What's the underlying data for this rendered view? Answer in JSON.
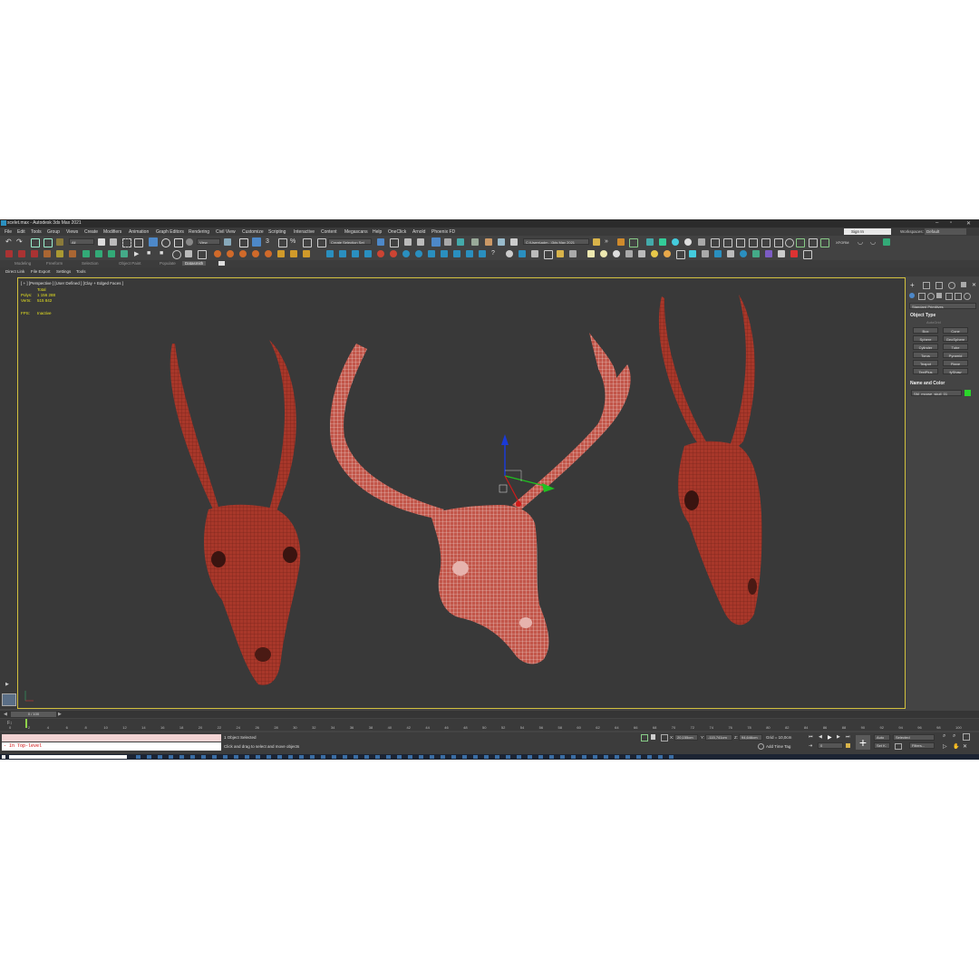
{
  "window": {
    "title": "scelet.max - Autodesk 3ds Max 2021"
  },
  "menu": [
    "File",
    "Edit",
    "Tools",
    "Group",
    "Views",
    "Create",
    "Modifiers",
    "Animation",
    "Graph Editors",
    "Rendering",
    "Civil View",
    "Customize",
    "Scripting",
    "Interactive",
    "Content",
    "Megascans",
    "Help",
    "OneClick",
    "Arnold",
    "Phoenix FD"
  ],
  "account": {
    "signin": "Sign In",
    "workspaces_label": "Workspaces:",
    "workspace": "Default"
  },
  "toolbar": {
    "filter": "All",
    "refcoord": "View",
    "selection_set": "Create Selection Set",
    "path": "C:\\Users\\adm...\\3ds Max 2021",
    "xform": "XFORM"
  },
  "ribbon": {
    "tabs": [
      "Modeling",
      "Freeform",
      "Selection",
      "Object Paint",
      "Populate",
      "Datasmith"
    ],
    "active": "Datasmith"
  },
  "ribbon2": [
    "Direct Link",
    "File Export",
    "Settings",
    "Tools"
  ],
  "viewport": {
    "label": "[ + ] [Perspective ] [User Defined ] [Clay + Edged Faces ]",
    "stats_total": "Total",
    "polys_label": "Polys:",
    "polys_value": "1 156 288",
    "verts_label": "Verts:",
    "verts_value": "515 842",
    "fps_label": "FPS:",
    "fps_value": "Inactive"
  },
  "command_panel": {
    "category": "Standard Primitives",
    "object_type": "Object Type",
    "autogrid": "AutoGrid",
    "buttons": [
      "Box",
      "Cone",
      "Sphere",
      "GeoSphere",
      "Cylinder",
      "Tube",
      "Torus",
      "Pyramid",
      "Teapot",
      "Plane",
      "TextPlus",
      "fyShaw"
    ],
    "name_and_color": "Name and Color",
    "object_name": "SM_moose_skull_01",
    "object_color": "#2bd62b"
  },
  "timeline": {
    "frame": "0 / 100",
    "ticks": [
      "0",
      "2",
      "4",
      "6",
      "8",
      "10",
      "12",
      "14",
      "16",
      "18",
      "20",
      "22",
      "24",
      "26",
      "28",
      "30",
      "32",
      "34",
      "36",
      "38",
      "40",
      "42",
      "44",
      "46",
      "48",
      "50",
      "52",
      "54",
      "56",
      "58",
      "60",
      "62",
      "64",
      "66",
      "68",
      "70",
      "72",
      "74",
      "76",
      "78",
      "80",
      "82",
      "84",
      "86",
      "88",
      "90",
      "92",
      "94",
      "96",
      "98",
      "100"
    ]
  },
  "status": {
    "maxscript": "- In Top-level",
    "selected": "1 Object Selected",
    "hint": "Click and drag to select and move objects",
    "x_label": "X:",
    "x_value": "20,155cm",
    "y_label": "Y:",
    "y_value": "-115,741cm",
    "z_label": "Z:",
    "z_value": "94,646cm",
    "grid": "Grid = 10,0cm",
    "add_time_tag": "Add Time Tag",
    "auto": "Auto",
    "set_key": "Set K.",
    "key_mode": "Selected",
    "filters": "Filters...",
    "frame_field": "0"
  },
  "colors": {
    "accent": "#d2c13d",
    "bg": "#393939",
    "skull": "#b23a2a",
    "skull_light": "#d27a6e"
  }
}
